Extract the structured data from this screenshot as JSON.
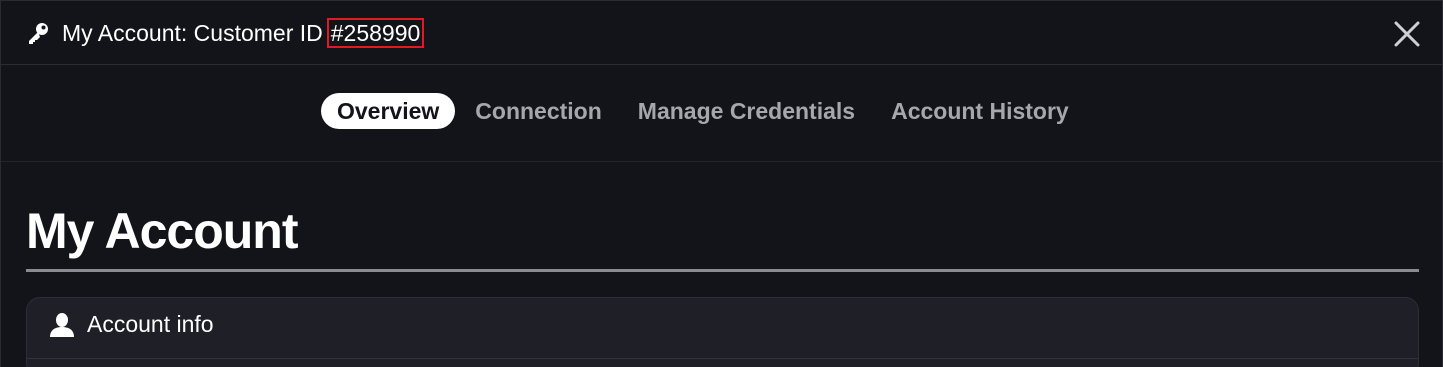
{
  "header": {
    "title_prefix": "My Account: Customer ID",
    "customer_id": "#258990",
    "key_icon": "key-icon",
    "close_icon": "close-icon"
  },
  "tabs": [
    {
      "label": "Overview",
      "active": true
    },
    {
      "label": "Connection",
      "active": false
    },
    {
      "label": "Manage Credentials",
      "active": false
    },
    {
      "label": "Account History",
      "active": false
    }
  ],
  "main": {
    "page_title": "My Account",
    "account_info_card": {
      "title": "Account info",
      "icon": "user-icon"
    }
  },
  "colors": {
    "background": "#13131a",
    "card_background": "#1f1f27",
    "highlight_border": "#e01a22",
    "active_tab_bg": "#ffffff",
    "inactive_tab_text": "#a6a6ad"
  }
}
